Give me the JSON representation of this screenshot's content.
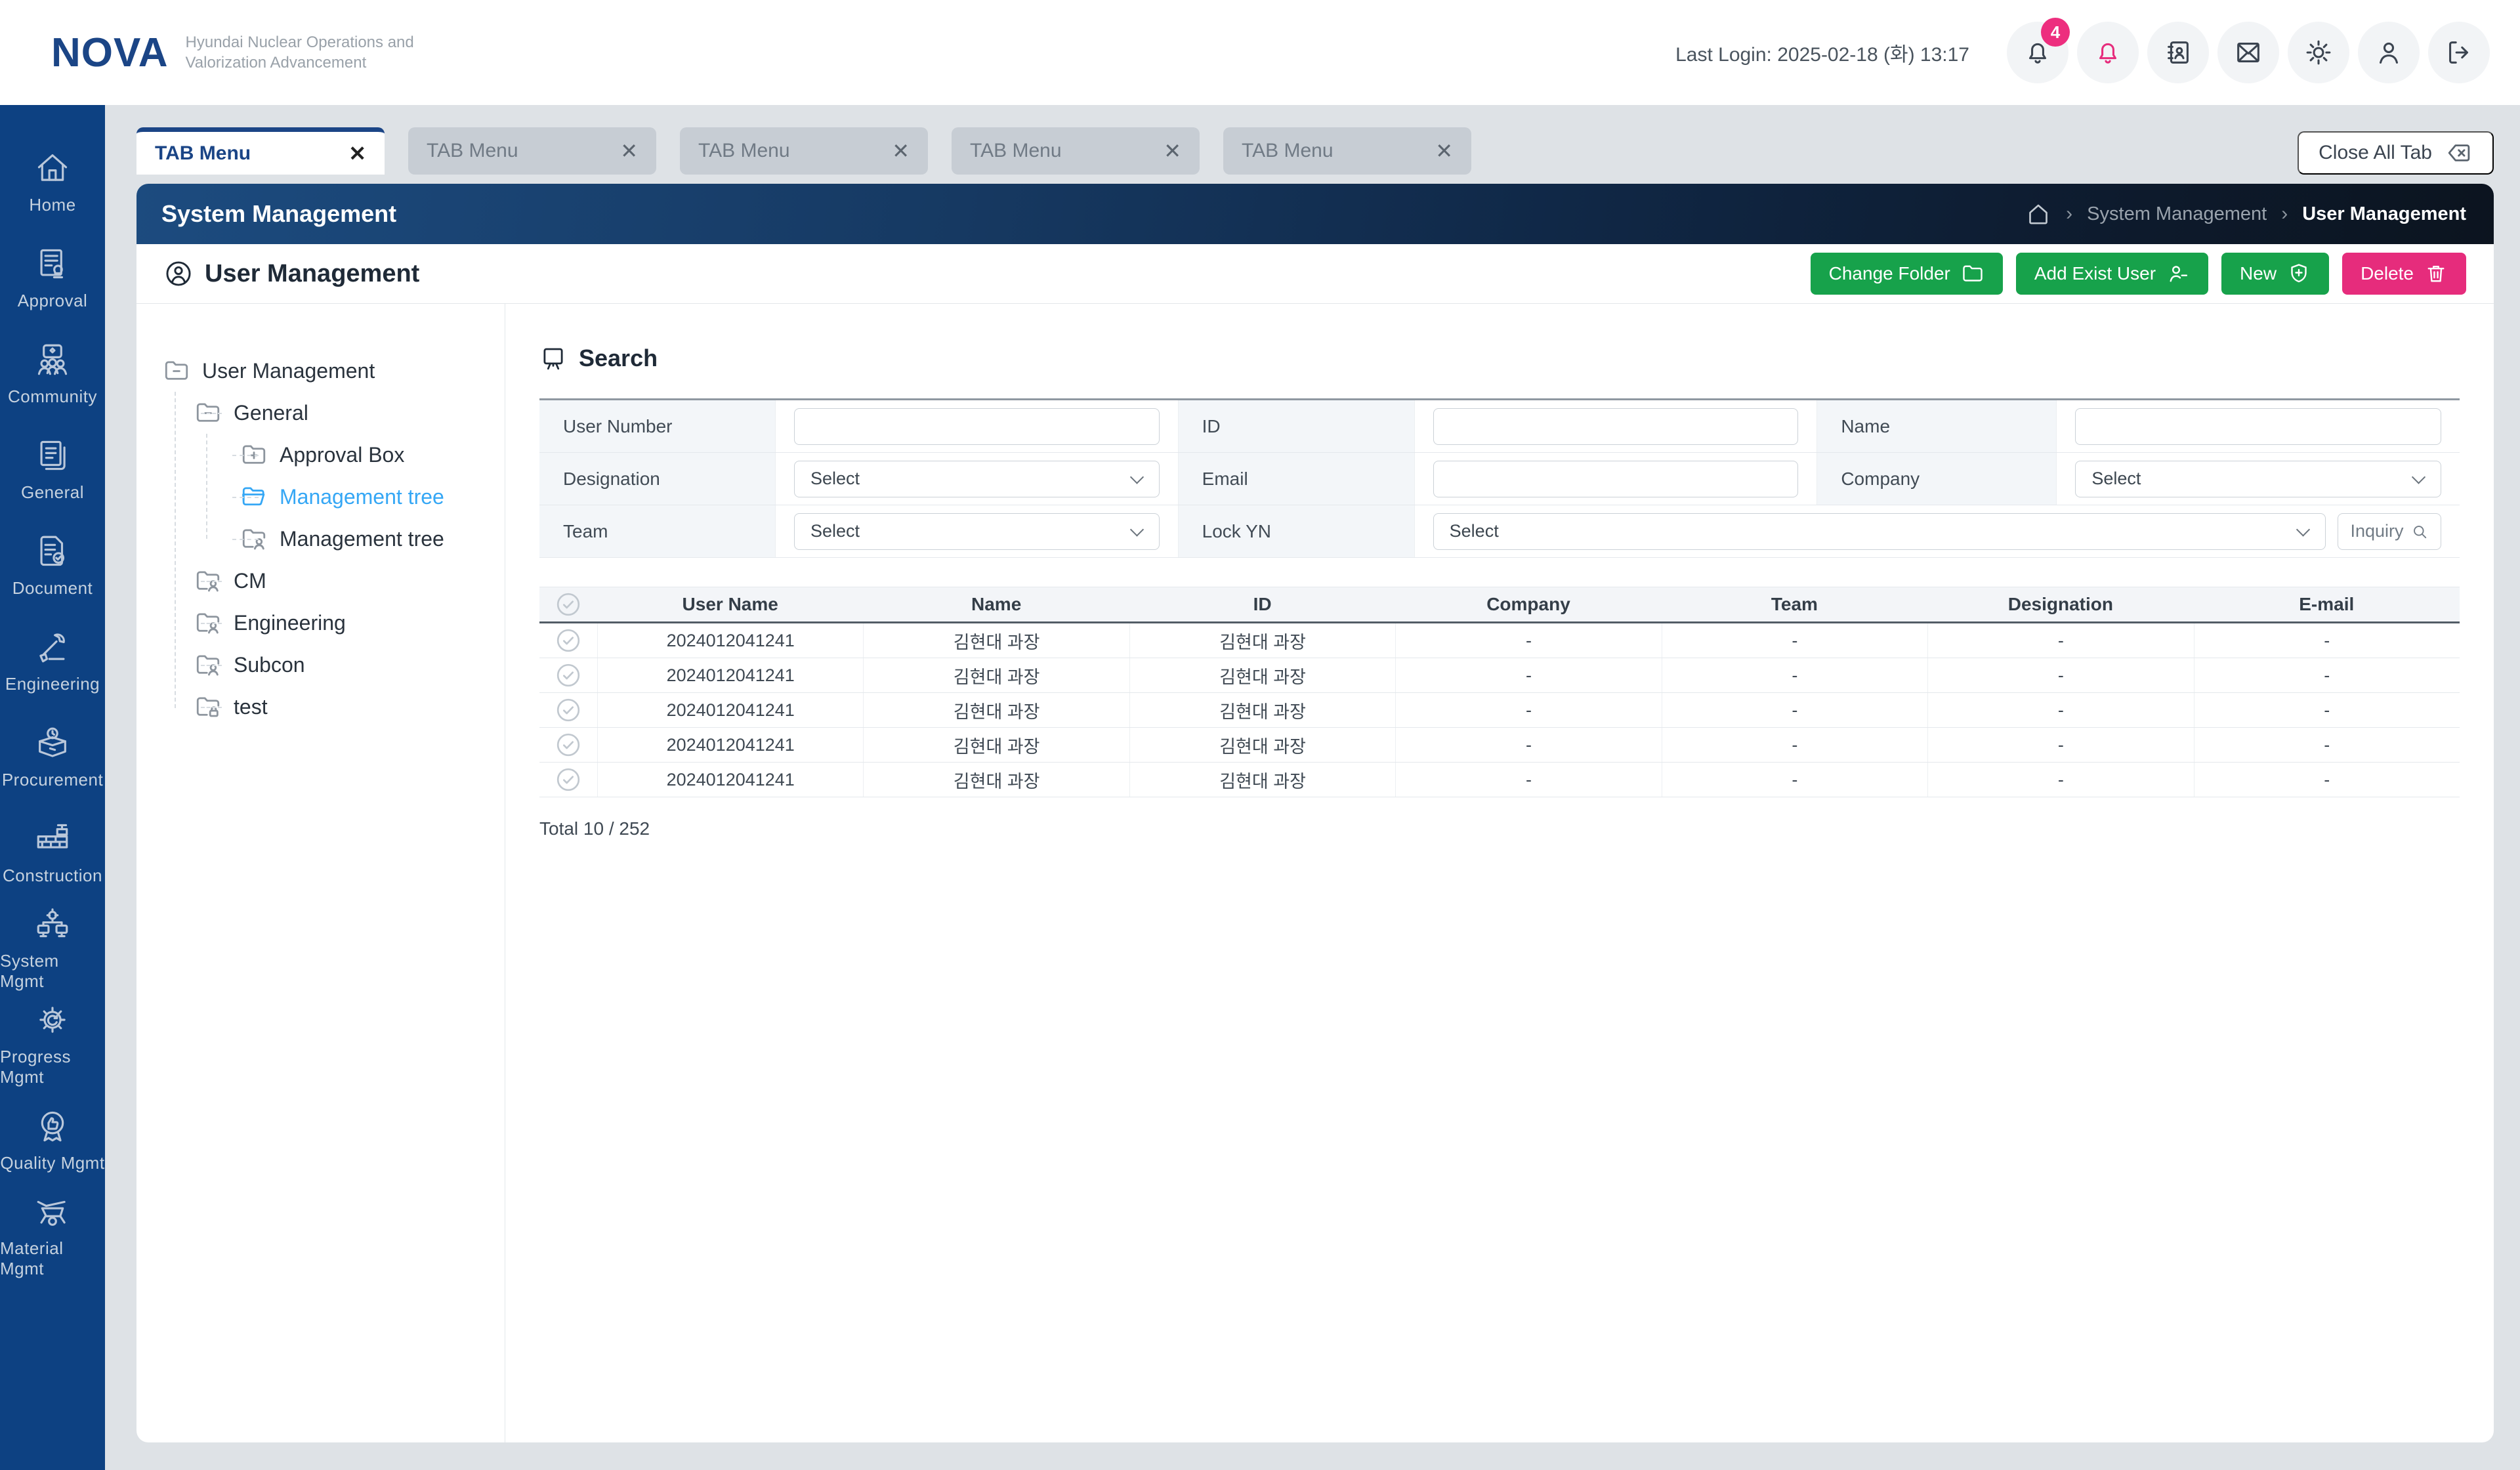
{
  "colors": {
    "brand_blue": "#1b4586",
    "sidebar_blue": "#0d4182",
    "green": "#17a24b",
    "pink": "#e62c7c",
    "tree_active_blue": "#35a7f5"
  },
  "header": {
    "logo": "NOVA",
    "tagline_line1": "Hyundai Nuclear Operations and",
    "tagline_line2": "Valorization Advancement",
    "last_login": "Last Login: 2025-02-18 (화) 13:17",
    "notification_badge": "4",
    "icons": [
      "notification-bell",
      "alert-bell",
      "contact-book",
      "mail",
      "settings-gear",
      "user",
      "logout"
    ]
  },
  "sidebar": {
    "items": [
      {
        "label": "Home"
      },
      {
        "label": "Approval"
      },
      {
        "label": "Community"
      },
      {
        "label": "General"
      },
      {
        "label": "Document"
      },
      {
        "label": "Engineering"
      },
      {
        "label": "Procurement"
      },
      {
        "label": "Construction"
      },
      {
        "label": "System Mgmt"
      },
      {
        "label": "Progress Mgmt"
      },
      {
        "label": "Quality Mgmt"
      },
      {
        "label": "Material Mgmt"
      }
    ]
  },
  "tabs": {
    "close_icon": "✕",
    "items": [
      {
        "label": "TAB Menu",
        "active": true
      },
      {
        "label": "TAB Menu",
        "active": false
      },
      {
        "label": "TAB Menu",
        "active": false
      },
      {
        "label": "TAB Menu",
        "active": false
      },
      {
        "label": "TAB Menu",
        "active": false
      }
    ],
    "close_all_label": "Close All Tab"
  },
  "page_bar": {
    "title": "System Management",
    "breadcrumb": [
      "System Management",
      "User Management"
    ]
  },
  "toolbar": {
    "title": "User Management",
    "change_folder_label": "Change Folder",
    "add_exist_user_label": "Add Exist User",
    "new_label": "New",
    "delete_label": "Delete"
  },
  "tree": {
    "items": [
      {
        "label": "User Management",
        "depth": 0,
        "icon": "folder-minus"
      },
      {
        "label": "General",
        "depth": 1,
        "icon": "folder-minus"
      },
      {
        "label": "Approval Box",
        "depth": 2,
        "icon": "folder-plus"
      },
      {
        "label": "Management tree",
        "depth": 2,
        "icon": "folder-open",
        "active": true
      },
      {
        "label": "Management tree",
        "depth": 2,
        "icon": "folder-user"
      },
      {
        "label": "CM",
        "depth": 1,
        "icon": "folder-user"
      },
      {
        "label": "Engineering",
        "depth": 1,
        "icon": "folder-user"
      },
      {
        "label": "Subcon",
        "depth": 1,
        "icon": "folder-user"
      },
      {
        "label": "test",
        "depth": 1,
        "icon": "folder-lock"
      }
    ]
  },
  "search": {
    "title": "Search",
    "labels": {
      "user_number": "User Number",
      "id": "ID",
      "name": "Name",
      "designation": "Designation",
      "email": "Email",
      "company": "Company",
      "team": "Team",
      "lock_yn": "Lock YN"
    },
    "select_placeholder": "Select",
    "inquiry_label": "Inquiry"
  },
  "table": {
    "headers": [
      "User Name",
      "Name",
      "ID",
      "Company",
      "Team",
      "Designation",
      "E-mail"
    ],
    "rows": [
      [
        "2024012041241",
        "김현대 과장",
        "김현대 과장",
        "-",
        "-",
        "-",
        "-"
      ],
      [
        "2024012041241",
        "김현대 과장",
        "김현대 과장",
        "-",
        "-",
        "-",
        "-"
      ],
      [
        "2024012041241",
        "김현대 과장",
        "김현대 과장",
        "-",
        "-",
        "-",
        "-"
      ],
      [
        "2024012041241",
        "김현대 과장",
        "김현대 과장",
        "-",
        "-",
        "-",
        "-"
      ],
      [
        "2024012041241",
        "김현대 과장",
        "김현대 과장",
        "-",
        "-",
        "-",
        "-"
      ]
    ],
    "total": "Total 10 / 252"
  }
}
